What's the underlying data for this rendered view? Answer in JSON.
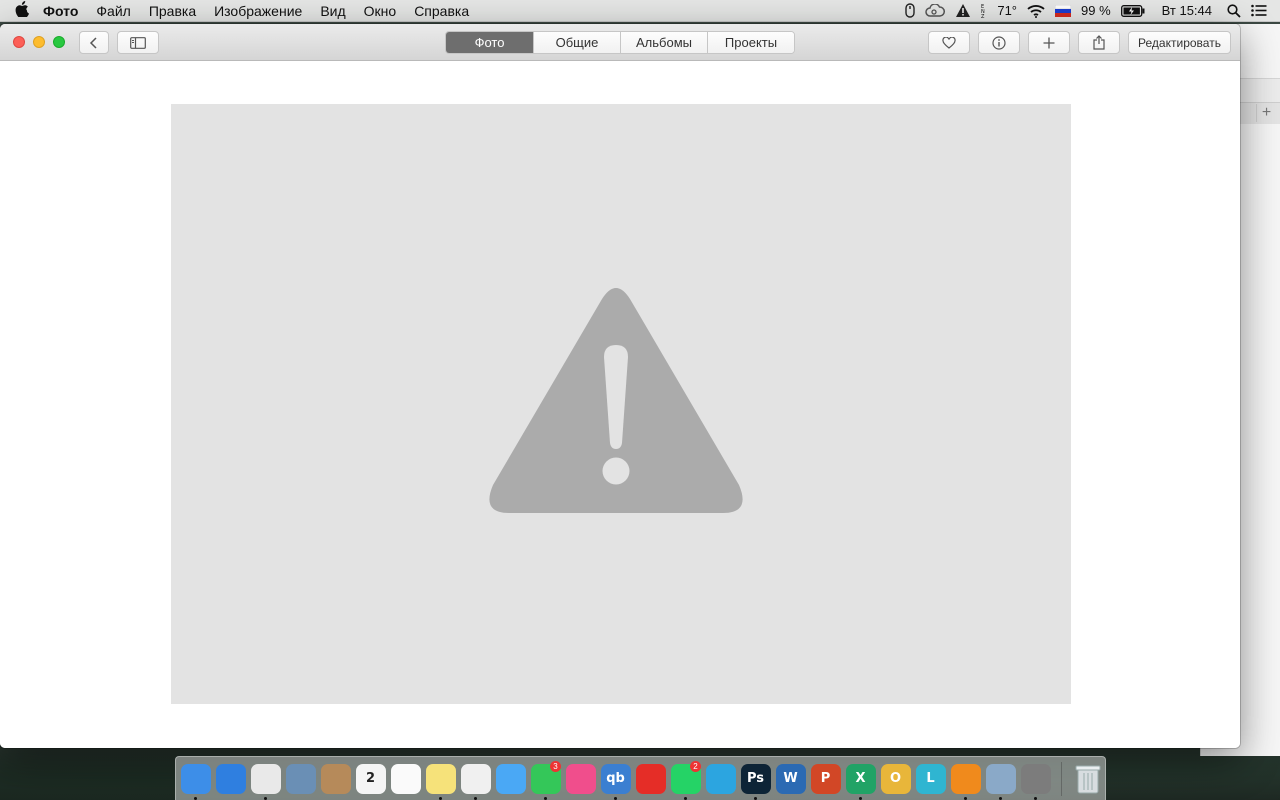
{
  "menubar": {
    "app_name": "Фото",
    "items": [
      "Файл",
      "Правка",
      "Изображение",
      "Вид",
      "Окно",
      "Справка"
    ],
    "status": {
      "temperature": "71°",
      "battery": "99 %",
      "clock": "Вт 15:44"
    }
  },
  "toolbar": {
    "tabs": [
      {
        "label": "Фото",
        "active": true
      },
      {
        "label": "Общие",
        "active": false
      },
      {
        "label": "Альбомы",
        "active": false
      },
      {
        "label": "Проекты",
        "active": false
      }
    ],
    "edit_label": "Редактировать"
  },
  "content": {
    "placeholder_icon": "warning-triangle-icon",
    "placeholder_bg": "#e3e3e3",
    "icon_color": "#ababab"
  },
  "dock": {
    "apps": [
      {
        "name": "finder",
        "label": "",
        "color": "#3d8ee8",
        "running": true
      },
      {
        "name": "safari",
        "label": "",
        "color": "#2f7fe0",
        "running": false
      },
      {
        "name": "chrome",
        "label": "",
        "color": "#e9e9e9",
        "running": true
      },
      {
        "name": "preview-scan",
        "label": "",
        "color": "#6a8fb5",
        "running": false
      },
      {
        "name": "contacts",
        "label": "",
        "color": "#b68a5a",
        "running": false
      },
      {
        "name": "calendar",
        "label": "2",
        "color": "#f5f5f5",
        "running": false
      },
      {
        "name": "reminders",
        "label": "",
        "color": "#fafafa",
        "running": false
      },
      {
        "name": "notes",
        "label": "",
        "color": "#f6e27a",
        "running": true
      },
      {
        "name": "photos",
        "label": "",
        "color": "#f0f0f0",
        "running": true
      },
      {
        "name": "messages",
        "label": "",
        "color": "#4aa8f5",
        "running": false
      },
      {
        "name": "facetime",
        "label": "",
        "color": "#34c759",
        "running": true,
        "badge": "3"
      },
      {
        "name": "itunes",
        "label": "",
        "color": "#f04e8c",
        "running": false
      },
      {
        "name": "qbittorrent",
        "label": "qb",
        "color": "#3b7fd1",
        "running": true
      },
      {
        "name": "youtube",
        "label": "",
        "color": "#e52d27",
        "running": false
      },
      {
        "name": "whatsapp",
        "label": "",
        "color": "#25d366",
        "running": true,
        "badge": "2"
      },
      {
        "name": "telegram",
        "label": "",
        "color": "#2ca5e0",
        "running": false
      },
      {
        "name": "photoshop",
        "label": "Ps",
        "color": "#0d2436",
        "running": true
      },
      {
        "name": "word",
        "label": "W",
        "color": "#2b6ab3",
        "running": false
      },
      {
        "name": "powerpoint",
        "label": "P",
        "color": "#d24726",
        "running": false
      },
      {
        "name": "excel",
        "label": "X",
        "color": "#21a366",
        "running": true
      },
      {
        "name": "outlook",
        "label": "O",
        "color": "#e8b63a",
        "running": false
      },
      {
        "name": "lightroom",
        "label": "L",
        "color": "#2fb5d1",
        "running": false
      },
      {
        "name": "vlc",
        "label": "",
        "color": "#f08a1c",
        "running": true
      },
      {
        "name": "image-capture",
        "label": "",
        "color": "#8aa9c8",
        "running": true
      },
      {
        "name": "system-preferences",
        "label": "",
        "color": "#7c7c7c",
        "running": true
      }
    ],
    "trash": {
      "name": "trash",
      "color": "#d8dde0"
    }
  }
}
